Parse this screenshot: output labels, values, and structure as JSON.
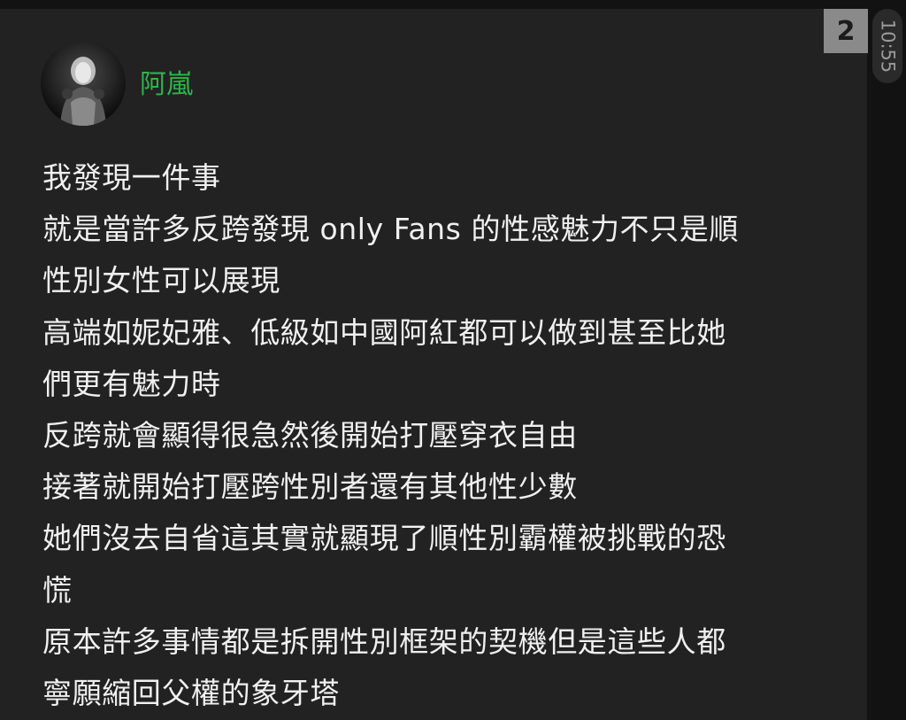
{
  "sender": {
    "name": "阿嵐",
    "name_color": "#2fb54a"
  },
  "message": {
    "lines": [
      "我發現一件事",
      "就是當許多反跨發現 only Fans 的性感魅力不只是順",
      "性別女性可以展現",
      "高端如妮妃雅、低級如中國阿紅都可以做到甚至比她",
      "們更有魅力時",
      "反跨就會顯得很急然後開始打壓穿衣自由",
      "接著就開始打壓跨性別者還有其他性少數",
      "她們沒去自省這其實就顯現了順性別霸權被挑戰的恐",
      "慌",
      "原本許多事情都是拆開性別框架的契機但是這些人都",
      "寧願縮回父權的象牙塔"
    ]
  },
  "badge": {
    "count": "2"
  },
  "timestamp": "10:55",
  "icons": {
    "avatar": "user-avatar-image"
  }
}
